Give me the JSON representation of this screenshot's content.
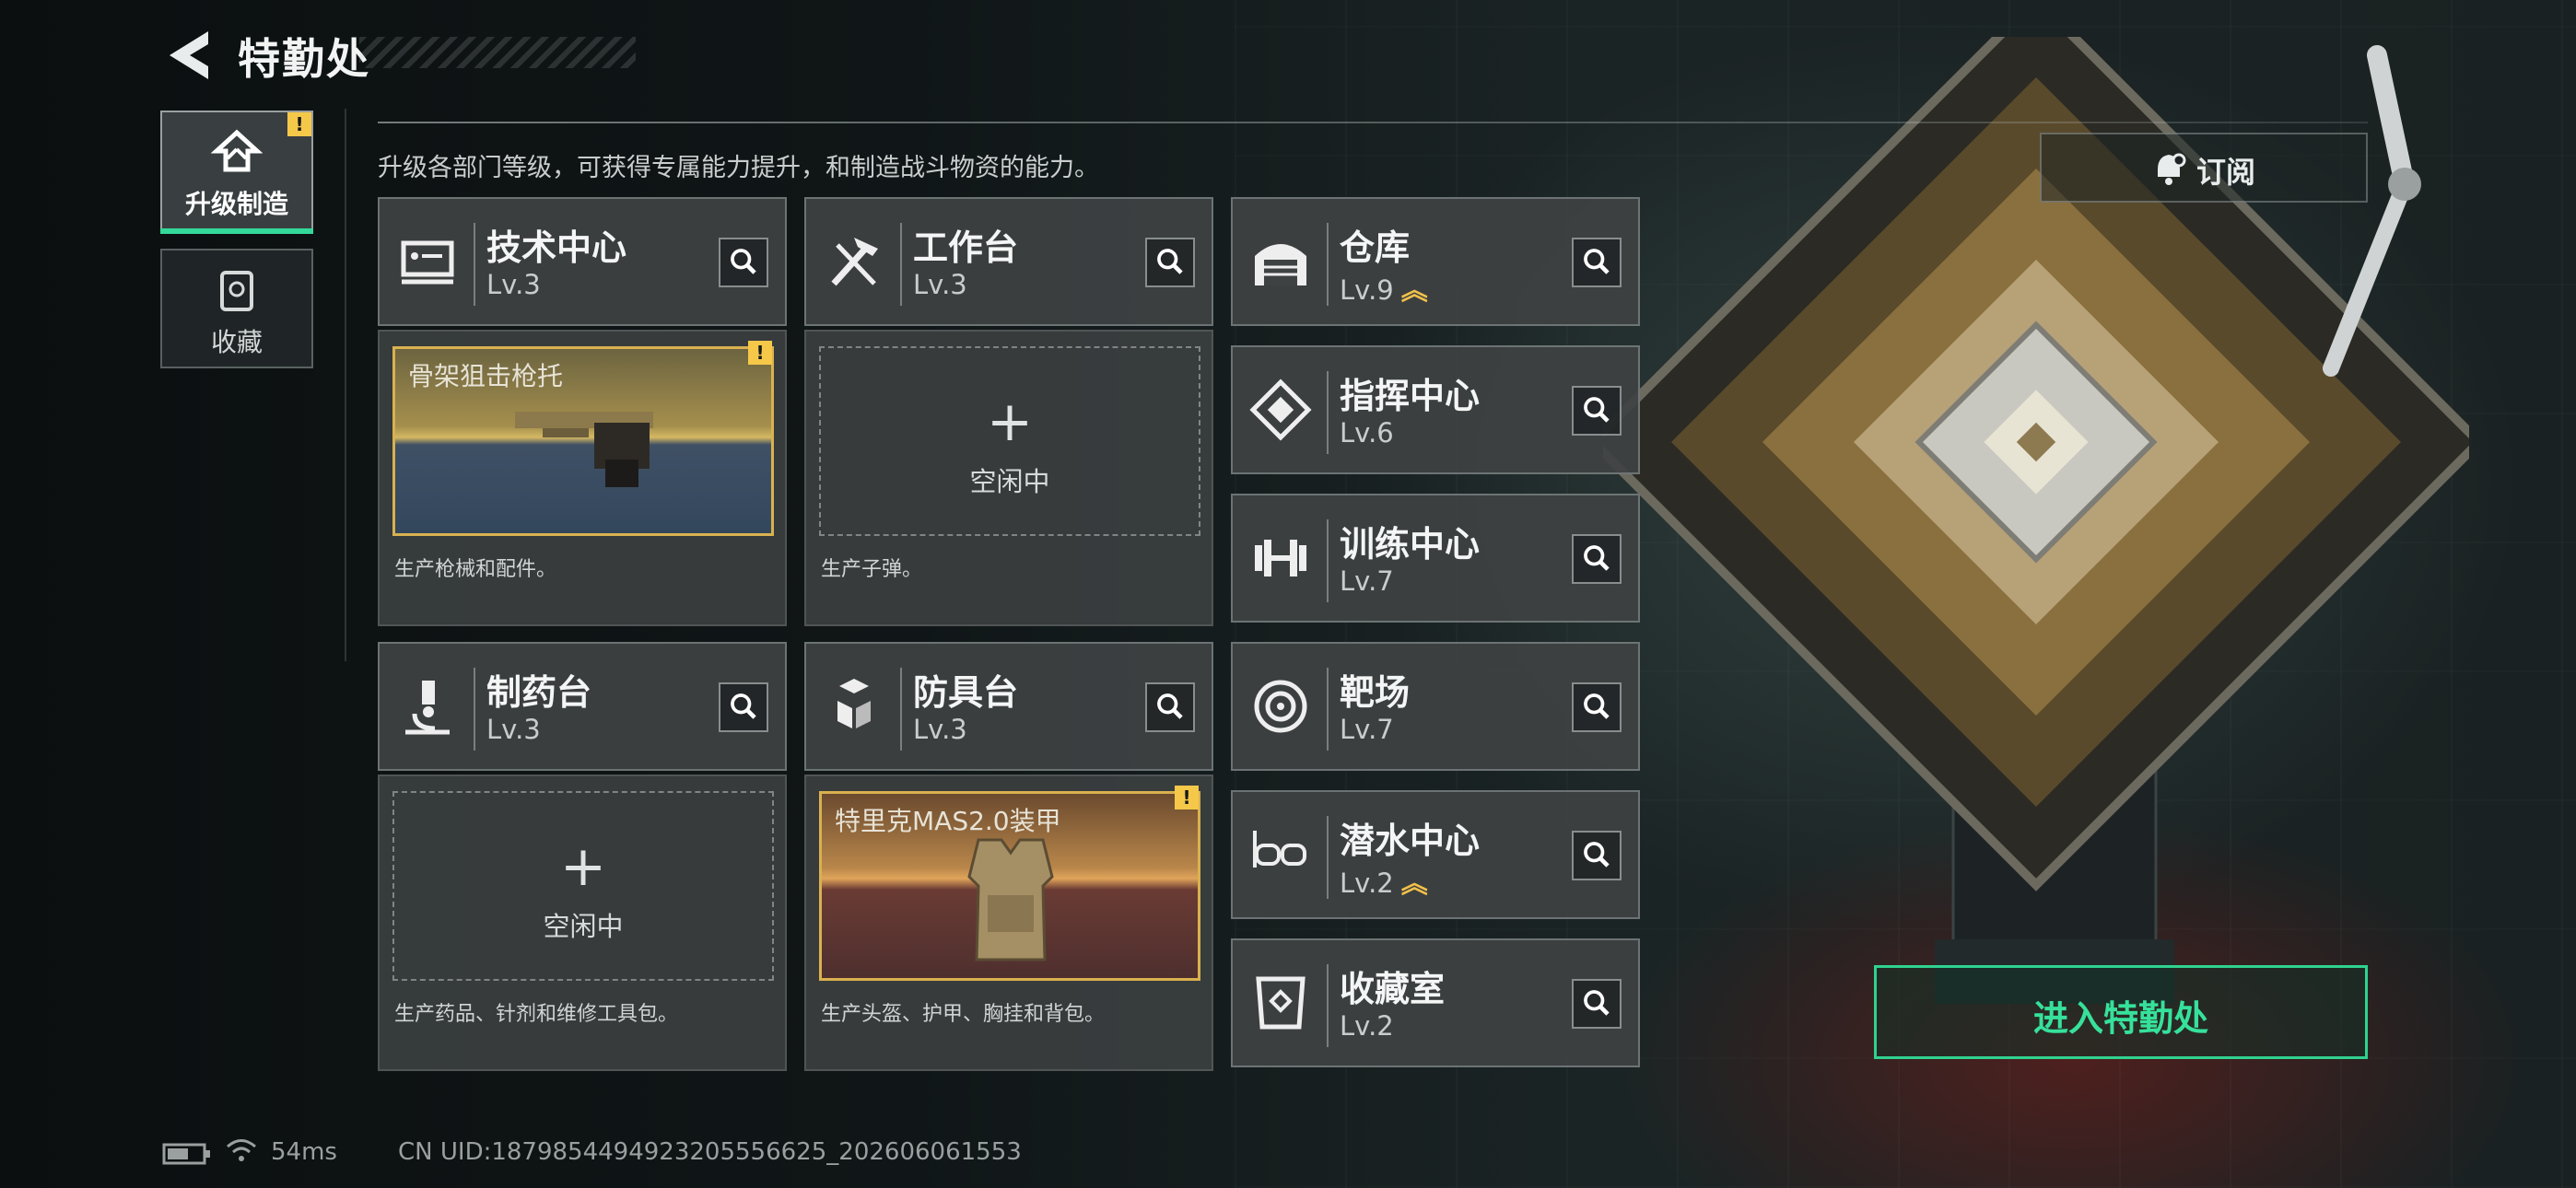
{
  "header": {
    "title": "特勤处",
    "subtitle": "升级各部门等级，可获得专属能力提升，和制造战斗物资的能力。"
  },
  "nav": [
    {
      "label": "升级制造",
      "active": true,
      "badge": "!"
    },
    {
      "label": "收藏",
      "active": false
    }
  ],
  "departments": [
    {
      "name": "技术中心",
      "level": "Lv.3",
      "icon": "tech-center-icon"
    },
    {
      "name": "工作台",
      "level": "Lv.3",
      "icon": "workbench-tools-icon"
    },
    {
      "name": "仓库",
      "level": "Lv.9",
      "icon": "warehouse-icon",
      "upgradable": true
    },
    {
      "name": "指挥中心",
      "level": "Lv.6",
      "icon": "command-center-icon"
    },
    {
      "name": "训练中心",
      "level": "Lv.7",
      "icon": "dumbbell-icon"
    },
    {
      "name": "制药台",
      "level": "Lv.3",
      "icon": "microscope-icon"
    },
    {
      "name": "防具台",
      "level": "Lv.3",
      "icon": "armor-blocks-icon"
    },
    {
      "name": "靶场",
      "level": "Lv.7",
      "icon": "target-icon"
    },
    {
      "name": "潜水中心",
      "level": "Lv.2",
      "icon": "diving-mask-icon",
      "upgradable": true
    },
    {
      "name": "收藏室",
      "level": "Lv.2",
      "icon": "collection-room-icon"
    }
  ],
  "production": [
    {
      "item": "骨架狙击枪托",
      "status": "",
      "description": "生产枪械和配件。",
      "badge": "!"
    },
    {
      "item": "",
      "status": "空闲中",
      "description": "生产子弹。"
    },
    {
      "item": "",
      "status": "空闲中",
      "description": "生产药品、针剂和维修工具包。"
    },
    {
      "item": "特里克MAS2.0装甲",
      "status": "",
      "description": "生产头盔、护甲、胸挂和背包。",
      "badge": "!"
    }
  ],
  "upgrade_glyph": "︽",
  "plus_glyph": "+",
  "subscribe_label": "订阅",
  "enter_label": "进入特勤处",
  "status_bar": {
    "ping": "54ms",
    "uid": "CN UID:1879854494923205556625_202606061553"
  },
  "colors": {
    "accent": "#33d99a",
    "badge": "#f5c84a",
    "slot_border": "#d9b14f"
  }
}
